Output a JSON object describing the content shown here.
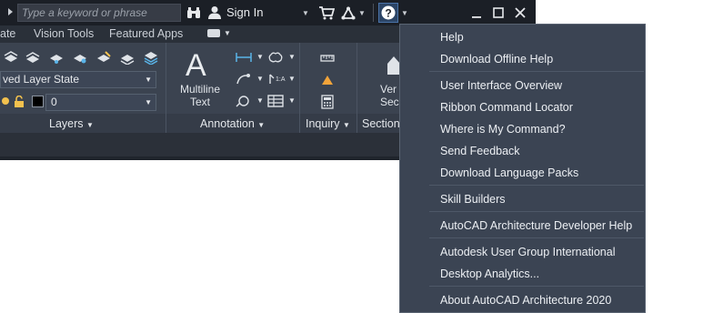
{
  "search": {
    "placeholder": "Type a keyword or phrase"
  },
  "titlebar": {
    "sign_in": "Sign In"
  },
  "tabs": [
    "ate",
    "Vision Tools",
    "Featured Apps"
  ],
  "ribbon": {
    "layer_state": "ved Layer State",
    "layer_value": "0",
    "panels": {
      "layers": "Layers",
      "annotation": "Annotation",
      "inquiry": "Inquiry",
      "section": "Section"
    },
    "multiline_text": [
      "Multiline",
      "Text"
    ],
    "vertical_section": [
      "Ver",
      "Sec"
    ]
  },
  "help_menu": {
    "items": [
      "Help",
      "Download Offline Help",
      "User Interface Overview",
      "Ribbon Command Locator",
      "Where is My Command?",
      "Send Feedback",
      "Download Language Packs",
      "Skill Builders",
      "AutoCAD Architecture Developer Help",
      "Autodesk User Group International",
      "Desktop Analytics...",
      "About AutoCAD Architecture 2020"
    ]
  }
}
